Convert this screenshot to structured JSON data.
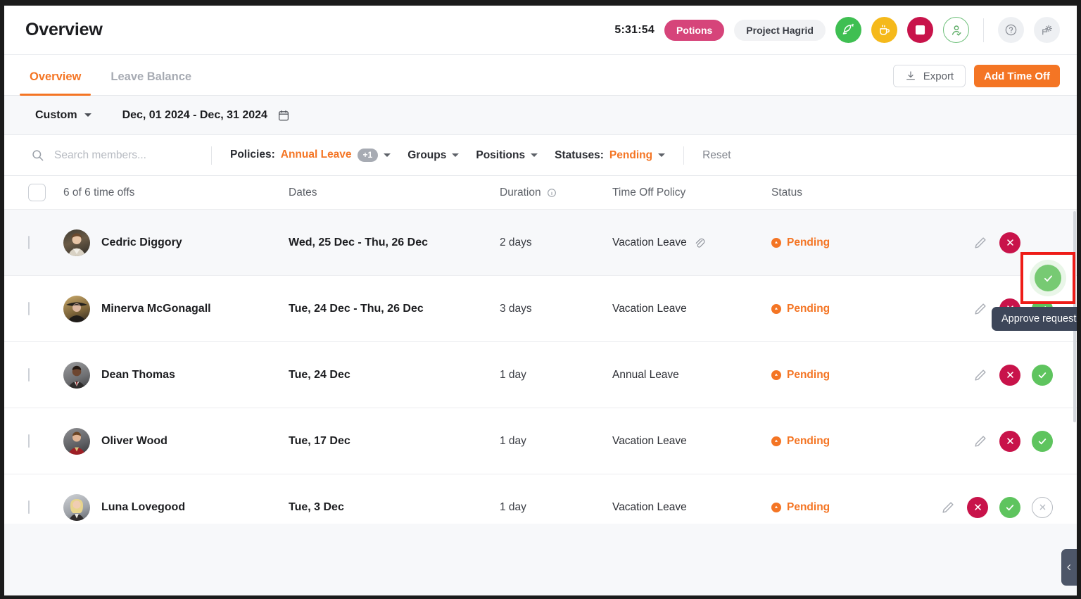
{
  "header": {
    "title": "Overview",
    "timer": "5:31:54",
    "task_pill": "Potions",
    "project_pill": "Project Hagrid",
    "accent_orange": "#f47524",
    "icons": {
      "activity": "rocket-icon",
      "break": "coffee-cup-icon",
      "stop": "stop-square-icon",
      "checkin": "person-check-icon",
      "help": "question-mark-icon",
      "settings": "settings-gear-icon"
    }
  },
  "tabs": [
    {
      "label": "Overview",
      "active": true
    },
    {
      "label": "Leave Balance",
      "active": false
    }
  ],
  "toolbar": {
    "export_label": "Export",
    "add_label": "Add Time Off"
  },
  "date_filter": {
    "preset": "Custom",
    "range": "Dec, 01 2024 - Dec, 31 2024"
  },
  "filters": {
    "search_placeholder": "Search members...",
    "search_value": "",
    "policies_label": "Policies",
    "policies_value": "Annual Leave",
    "policies_extra": "+1",
    "groups_label": "Groups",
    "positions_label": "Positions",
    "statuses_label": "Statuses",
    "statuses_value": "Pending",
    "reset_label": "Reset"
  },
  "table": {
    "columns": {
      "count": "6 of 6 time offs",
      "dates": "Dates",
      "duration": "Duration",
      "policy": "Time Off Policy",
      "status": "Status"
    },
    "rows": [
      {
        "name": "Cedric Diggory",
        "dates": "Wed, 25 Dec - Thu, 26 Dec",
        "duration": "2 days",
        "policy": "Vacation Leave",
        "has_attachment": true,
        "status": "Pending",
        "has_cancel": false
      },
      {
        "name": "Minerva McGonagall",
        "dates": "Tue, 24 Dec - Thu, 26 Dec",
        "duration": "3 days",
        "policy": "Vacation Leave",
        "has_attachment": false,
        "status": "Pending",
        "has_cancel": false
      },
      {
        "name": "Dean Thomas",
        "dates": "Tue, 24 Dec",
        "duration": "1 day",
        "policy": "Annual Leave",
        "has_attachment": false,
        "status": "Pending",
        "has_cancel": false
      },
      {
        "name": "Oliver Wood",
        "dates": "Tue, 17 Dec",
        "duration": "1 day",
        "policy": "Vacation Leave",
        "has_attachment": false,
        "status": "Pending",
        "has_cancel": false
      },
      {
        "name": "Luna Lovegood",
        "dates": "Tue, 3 Dec",
        "duration": "1 day",
        "policy": "Vacation Leave",
        "has_attachment": false,
        "status": "Pending",
        "has_cancel": true
      }
    ]
  },
  "tooltip": {
    "text": "Approve request"
  },
  "colors": {
    "orange": "#f47524",
    "crimson": "#c8134a",
    "green": "#5ec45e",
    "pink": "#d6447a",
    "highlight_red": "#ee1c18"
  }
}
